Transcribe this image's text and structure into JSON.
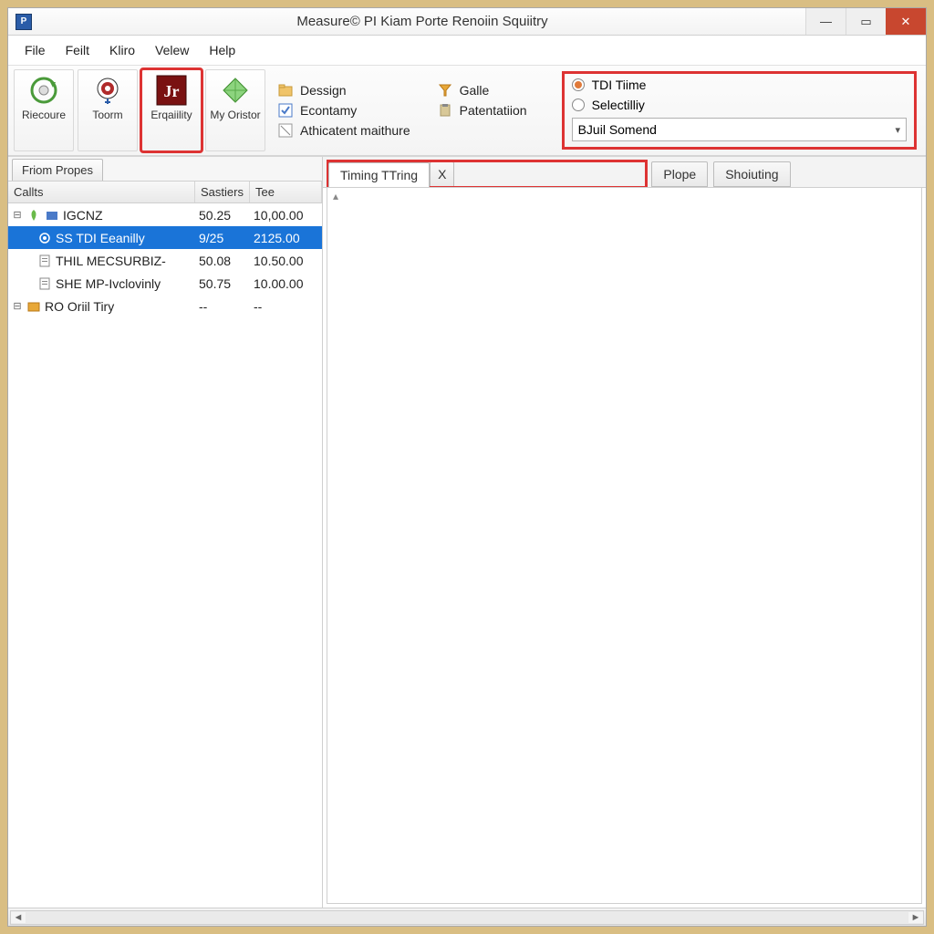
{
  "window": {
    "title": "Measure© PI Kiam Porte Renoiin Squiitry"
  },
  "menu": {
    "items": [
      "File",
      "Feilt",
      "Kliro",
      "Velew",
      "Help"
    ]
  },
  "toolbar": {
    "buttons": [
      {
        "label": "Riecoure"
      },
      {
        "label": "Toorm"
      },
      {
        "label": "Erqaiility"
      },
      {
        "label": "My Oristor"
      }
    ]
  },
  "options": {
    "col1": [
      {
        "label": "Dessign"
      },
      {
        "label": "Econtamy"
      },
      {
        "label": "Athicatent maithure"
      }
    ],
    "col2": [
      {
        "label": "Galle"
      },
      {
        "label": "Patentatiion"
      }
    ]
  },
  "radio": {
    "opt1": "TDI Tiime",
    "opt2": "Selectilliy",
    "combo": "BJuil Somend"
  },
  "leftPanel": {
    "tab": "Friom Propes",
    "headers": {
      "a": "Callts",
      "b": "Sastiers",
      "c": "Tee"
    },
    "rows": [
      {
        "name": "IGCNZ",
        "s": "50.25",
        "t": "10,00.00",
        "depth": 0,
        "exp": "−",
        "icon": "folder"
      },
      {
        "name": "SS TDI Eeanilly",
        "s": "9/25",
        "t": "2125.00",
        "depth": 1,
        "sel": true,
        "icon": "gear"
      },
      {
        "name": "THIL MECSURBIZ-",
        "s": "50.08",
        "t": "10.50.00",
        "depth": 1,
        "icon": "doc"
      },
      {
        "name": "SHE MP-Ivclovinly",
        "s": "50.75",
        "t": "10.00.00",
        "depth": 1,
        "icon": "doc"
      },
      {
        "name": "RO Oriil Tiry",
        "s": "--",
        "t": "--",
        "depth": 0,
        "exp": "−",
        "icon": "folder2"
      }
    ]
  },
  "tabs": {
    "t1": "Timing TTring",
    "tx": "X",
    "t2": "Plope",
    "t3": "Shoiuting"
  }
}
